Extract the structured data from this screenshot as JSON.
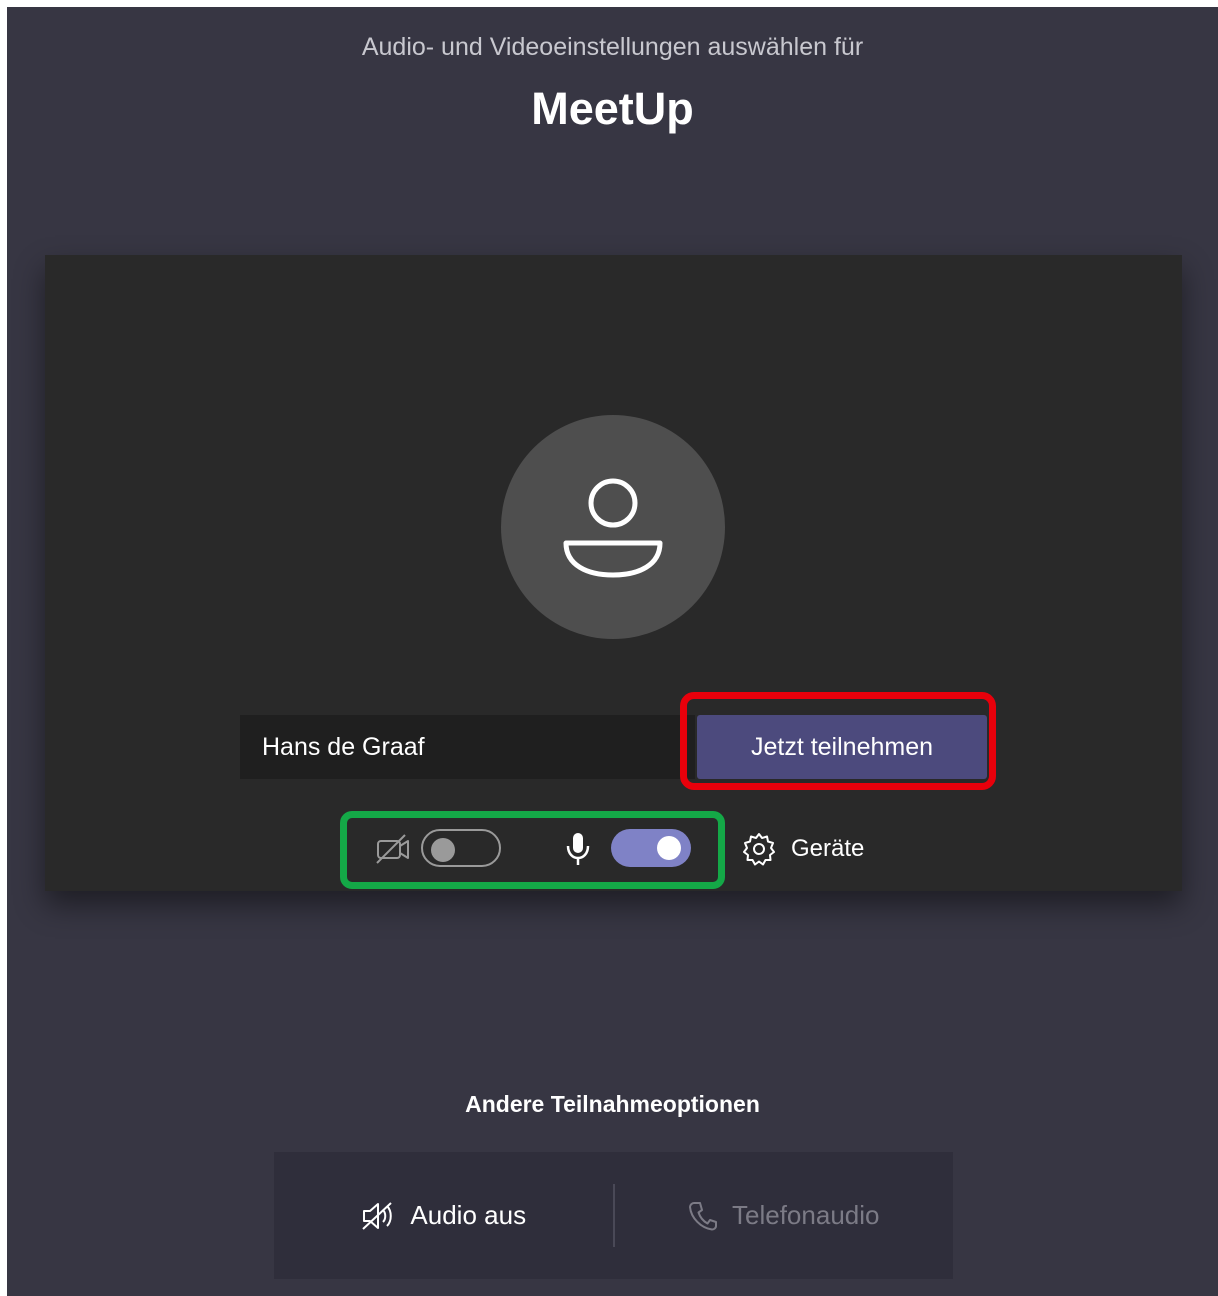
{
  "header": {
    "subtitle": "Audio- und Videoeinstellungen auswählen für",
    "title": "MeetUp"
  },
  "preview": {
    "avatar_icon": "person-icon",
    "name_value": "Hans de Graaf",
    "join_label": "Jetzt teilnehmen"
  },
  "controls": {
    "camera_icon": "camera-off-icon",
    "camera_enabled": false,
    "mic_icon": "microphone-icon",
    "mic_enabled": true,
    "devices_icon": "gear-icon",
    "devices_label": "Geräte"
  },
  "other_options": {
    "title": "Andere Teilnahmeoptionen",
    "items": [
      {
        "icon": "speaker-off-icon",
        "label": "Audio aus",
        "enabled": true
      },
      {
        "icon": "phone-icon",
        "label": "Telefonaudio",
        "enabled": false
      }
    ]
  },
  "colors": {
    "background": "#373643",
    "preview_bg": "#292929",
    "join_button": "#4c4a7d",
    "toggle_on": "#7f82c6",
    "highlight_red": "#e8000b",
    "highlight_green": "#14a847"
  }
}
